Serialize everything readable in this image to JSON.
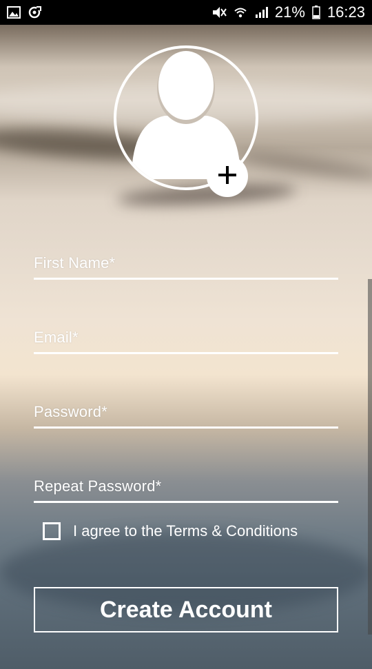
{
  "status_bar": {
    "time": "16:23",
    "battery_percent": "21%",
    "icons": [
      "gallery-icon",
      "sync-icon",
      "mute-vibrate-icon",
      "wifi-icon",
      "signal-icon",
      "battery-icon"
    ]
  },
  "avatar": {
    "icon": "user-placeholder-icon",
    "add_icon": "plus-icon"
  },
  "form": {
    "first_name_placeholder": "First Name*",
    "email_placeholder": "Email*",
    "password_placeholder": "Password*",
    "repeat_password_placeholder": "Repeat Password*",
    "terms_label": "I agree to the Terms & Conditions",
    "terms_checked": false,
    "create_account_label": "Create Account"
  },
  "colors": {
    "foreground": "#ffffff",
    "status_bar_bg": "#000000"
  }
}
